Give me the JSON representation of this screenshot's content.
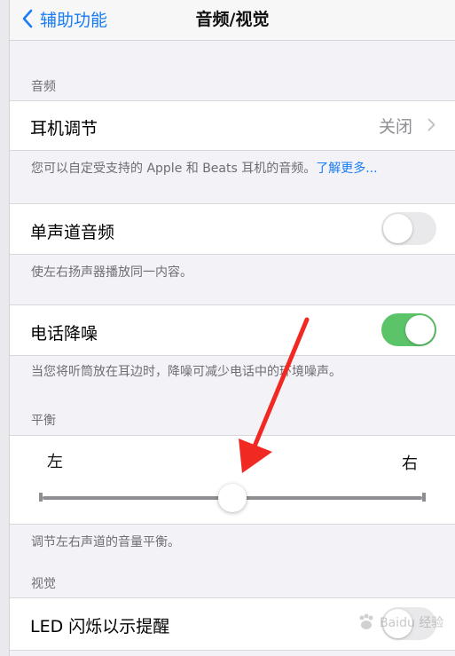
{
  "nav": {
    "back_label": "辅助功能",
    "title": "音频/视觉"
  },
  "sections": {
    "audio_header": "音频",
    "balance_header": "平衡",
    "visual_header": "视觉"
  },
  "headphone": {
    "label": "耳机调节",
    "value": "关闭",
    "footer_text": "您可以自定受支持的 Apple 和 Beats 耳机的音频。",
    "footer_link": "了解更多..."
  },
  "mono_audio": {
    "label": "单声道音频",
    "on": false,
    "footer": "使左右扬声器播放同一内容。"
  },
  "noise_cancel": {
    "label": "电话降噪",
    "on": true,
    "footer": "当您将听筒放在耳边时，降噪可减少电话中的环境噪声。"
  },
  "balance": {
    "left_label": "左",
    "right_label": "右",
    "value": 0.5,
    "footer": "调节左右声道的音量平衡。"
  },
  "led_flash": {
    "label": "LED 闪烁以示提醒",
    "on": false
  },
  "colors": {
    "accent": "#1a7cf5",
    "toggle_on": "#5cc468",
    "annotation_arrow": "#f02a22"
  },
  "icons": {
    "back": "chevron-left-icon",
    "disclosure": "chevron-right-icon"
  },
  "watermark": {
    "text": "Baidu 经验"
  }
}
